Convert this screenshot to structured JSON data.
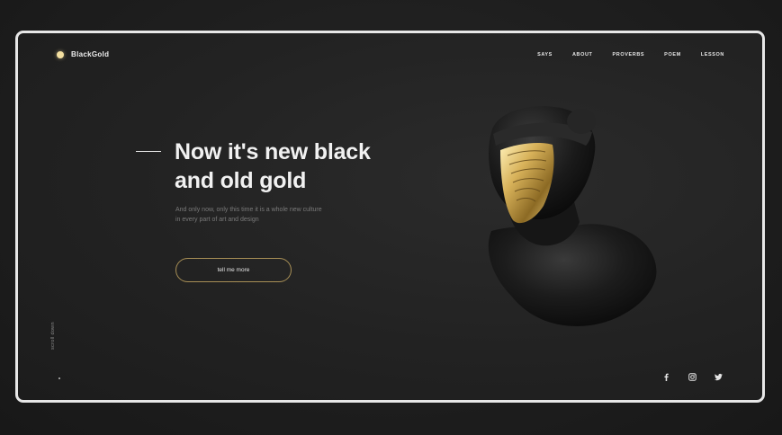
{
  "brand": {
    "name": "BlackGold",
    "dot_color": "#f3dfa0"
  },
  "nav": {
    "items": [
      {
        "label": "SAYS"
      },
      {
        "label": "ABOUT"
      },
      {
        "label": "PROVERBS"
      },
      {
        "label": "POEM"
      },
      {
        "label": "LESSON"
      }
    ]
  },
  "hero": {
    "title_line1": "Now it's new black",
    "title_line2": "and old gold",
    "subtitle_line1": "And only now, only this time it is a whole new culture",
    "subtitle_line2": "in every part of art and design",
    "cta_label": "tell me more"
  },
  "scroll": {
    "label": "scroll down"
  },
  "social": {
    "icons": [
      "facebook-icon",
      "instagram-icon",
      "twitter-icon"
    ]
  },
  "colors": {
    "accent_gold": "#c9a449",
    "background": "#222222",
    "frame_border": "#e7e7e7"
  }
}
